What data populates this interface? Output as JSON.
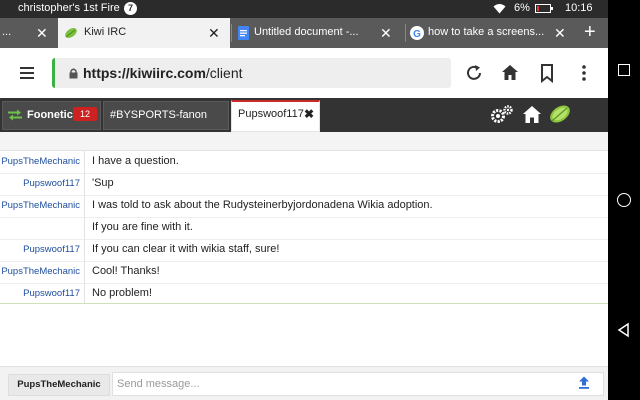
{
  "status_bar": {
    "device_name": "christopher's 1st Fire",
    "notification_count": "7",
    "battery_percent": "6%",
    "time": "10:16"
  },
  "browser": {
    "tabs": [
      {
        "title": "...",
        "active": false
      },
      {
        "title": "Kiwi IRC",
        "active": true
      },
      {
        "title": "Untitled document -...",
        "active": false
      },
      {
        "title": "how to take a screens...",
        "active": false
      }
    ],
    "url_bold": "https://",
    "url_domain": "kiwiirc.com",
    "url_path": "/client"
  },
  "kiwi": {
    "network_name": "Foonetic",
    "network_badge": "12",
    "channel": "#BYSPORTS-fanon",
    "query": "Pupswoof117",
    "accent_color": "#c92a2a"
  },
  "messages": [
    {
      "nick": "PupsTheMechanic",
      "text": "I have a question."
    },
    {
      "nick": "Pupswoof117",
      "text": "'Sup"
    },
    {
      "nick": "PupsTheMechanic",
      "text": "I was told to ask about the Rudysteinerbyjordonadena Wikia adoption."
    },
    {
      "nick": "",
      "text": "If you are fine with it."
    },
    {
      "nick": "Pupswoof117",
      "text": "If you can clear it with wikia staff, sure!"
    },
    {
      "nick": "PupsTheMechanic",
      "text": "Cool! Thanks!"
    },
    {
      "nick": "Pupswoof117",
      "text": "No problem!"
    }
  ],
  "input": {
    "current_nick": "PupsTheMechanic",
    "placeholder": "Send message...",
    "value": ""
  }
}
